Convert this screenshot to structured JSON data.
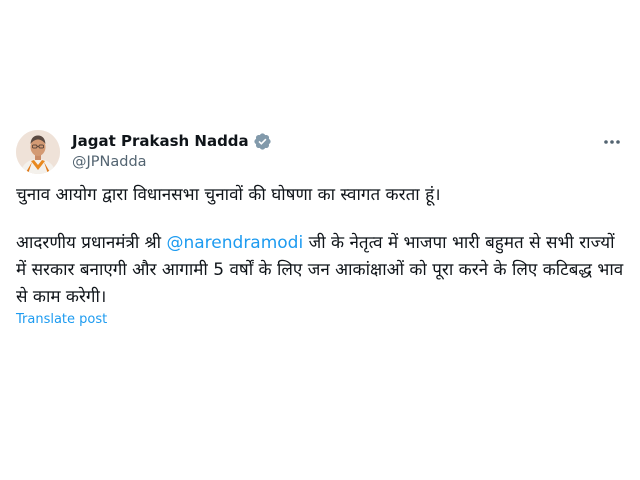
{
  "author": {
    "display_name": "Jagat Prakash Nadda",
    "handle": "@JPNadda",
    "verified": true
  },
  "post": {
    "paragraph_1": "चुनाव आयोग द्वारा विधानसभा चुनावों की घोषणा का स्वागत करता हूं।",
    "paragraph_2_prefix": "आदरणीय प्रधानमंत्री श्री ",
    "mention": "@narendramodi",
    "paragraph_2_suffix": " जी के नेतृत्व में भाजपा भारी बहुमत से सभी राज्यों में  सरकार बनाएगी और आगामी 5 वर्षों के लिए जन आकांक्षाओं को पूरा करने के लिए कटिबद्ध भाव से काम करेगी।"
  },
  "translate_label": "Translate post",
  "icons": {
    "avatar": "avatar-photo",
    "verified": "verified-badge-icon",
    "more": "more-options-icon"
  },
  "colors": {
    "link": "#1d9bf0",
    "text": "#0f1419",
    "secondary": "#536471",
    "verified_badge": "#829aab"
  }
}
